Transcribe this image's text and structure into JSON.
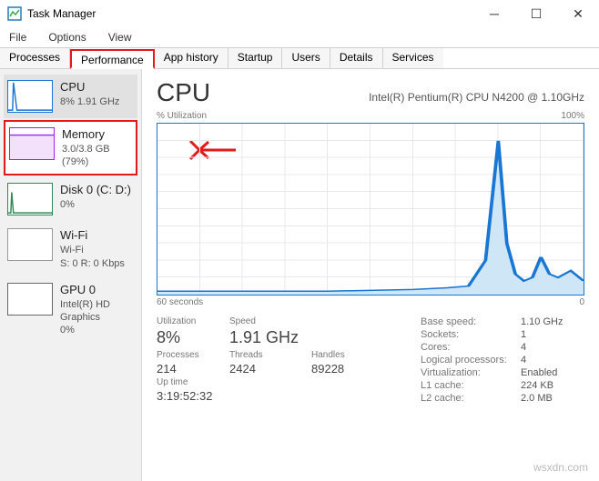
{
  "title": "Task Manager",
  "menu": {
    "file": "File",
    "options": "Options",
    "view": "View"
  },
  "tabs": {
    "processes": "Processes",
    "performance": "Performance",
    "app_history": "App history",
    "startup": "Startup",
    "users": "Users",
    "details": "Details",
    "services": "Services"
  },
  "sidebar": {
    "cpu": {
      "title": "CPU",
      "detail": "8% 1.91 GHz"
    },
    "memory": {
      "title": "Memory",
      "detail": "3.0/3.8 GB (79%)"
    },
    "disk": {
      "title": "Disk 0 (C: D:)",
      "detail": "0%"
    },
    "wifi": {
      "title": "Wi-Fi",
      "line1": "Wi-Fi",
      "line2": "S: 0 R: 0 Kbps"
    },
    "gpu": {
      "title": "GPU 0",
      "line1": "Intel(R) HD Graphics",
      "line2": "0%"
    }
  },
  "main": {
    "title": "CPU",
    "model": "Intel(R) Pentium(R) CPU N4200 @ 1.10GHz",
    "util_label": "% Utilization",
    "util_max": "100%",
    "x_left": "60 seconds",
    "x_right": "0",
    "stats": {
      "utilization_label": "Utilization",
      "utilization": "8%",
      "speed_label": "Speed",
      "speed": "1.91 GHz",
      "processes_label": "Processes",
      "processes": "214",
      "threads_label": "Threads",
      "threads": "2424",
      "handles_label": "Handles",
      "handles": "89228",
      "uptime_label": "Up time",
      "uptime": "3:19:52:32"
    },
    "info": {
      "base_speed_label": "Base speed:",
      "base_speed": "1.10 GHz",
      "sockets_label": "Sockets:",
      "sockets": "1",
      "cores_label": "Cores:",
      "cores": "4",
      "logical_label": "Logical processors:",
      "logical": "4",
      "virt_label": "Virtualization:",
      "virt": "Enabled",
      "l1_label": "L1 cache:",
      "l1": "224 KB",
      "l2_label": "L2 cache:",
      "l2": "2.0 MB"
    }
  },
  "chart_data": {
    "type": "line",
    "title": "CPU % Utilization",
    "xlabel": "seconds ago",
    "ylabel": "% Utilization",
    "xlim": [
      60,
      0
    ],
    "ylim": [
      0,
      100
    ],
    "x": [
      60,
      54,
      48,
      42,
      36,
      30,
      24,
      18,
      15,
      12,
      10,
      9,
      8,
      6,
      5,
      4,
      3,
      2,
      1,
      0
    ],
    "values": [
      2,
      2,
      2,
      2,
      2,
      2,
      3,
      3,
      5,
      20,
      90,
      30,
      12,
      8,
      10,
      22,
      12,
      10,
      14,
      8
    ]
  },
  "watermark": "wsxdn.com"
}
